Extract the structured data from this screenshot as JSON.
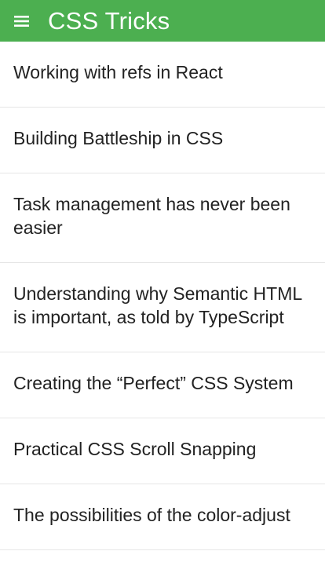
{
  "app": {
    "title": "CSS Tricks",
    "menu_icon": "hamburger-menu-icon",
    "brand_color": "#4caf50",
    "header_text_color": "#ffffff"
  },
  "articles": [
    {
      "title": "Working with refs in React"
    },
    {
      "title": "Building Battleship in CSS"
    },
    {
      "title": "Task management has never been easier"
    },
    {
      "title": "Understanding why Semantic HTML is important, as told by TypeScript"
    },
    {
      "title": "Creating the “Perfect” CSS System"
    },
    {
      "title": "Practical CSS Scroll Snapping"
    },
    {
      "title": "The possibilities of the color-adjust"
    }
  ]
}
